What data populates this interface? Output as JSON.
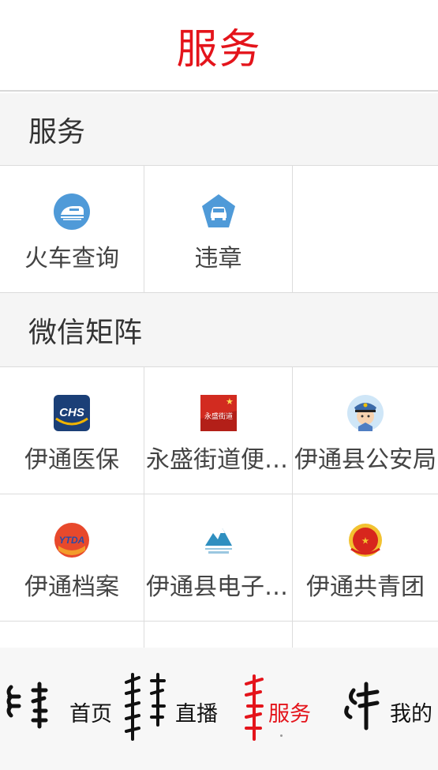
{
  "header": {
    "title": "服务"
  },
  "sections": [
    {
      "title": "服务"
    },
    {
      "title": "微信矩阵"
    }
  ],
  "service_items": [
    {
      "label": "火车查询",
      "icon": "train-icon"
    },
    {
      "label": "违章",
      "icon": "car-icon"
    }
  ],
  "wechat_items": [
    {
      "label": "伊通医保",
      "icon": "chs-logo-icon"
    },
    {
      "label": "永盛街道便民服务",
      "icon": "yongsheng-street-icon"
    },
    {
      "label": "伊通县公安局",
      "icon": "police-avatar-icon"
    },
    {
      "label": "伊通档案",
      "icon": "ytda-logo-icon"
    },
    {
      "label": "伊通县电子商务",
      "icon": "mountain-logo-icon"
    },
    {
      "label": "伊通共青团",
      "icon": "youth-league-icon"
    }
  ],
  "tabbar": {
    "items": [
      {
        "label": "首页",
        "active": false
      },
      {
        "label": "直播",
        "active": false
      },
      {
        "label": "服务",
        "active": true
      },
      {
        "label": "我的",
        "active": false
      }
    ]
  },
  "colors": {
    "accent": "#e4141b",
    "text": "#444444",
    "divider": "#dcdcdc",
    "section_bg": "#f5f5f5"
  }
}
